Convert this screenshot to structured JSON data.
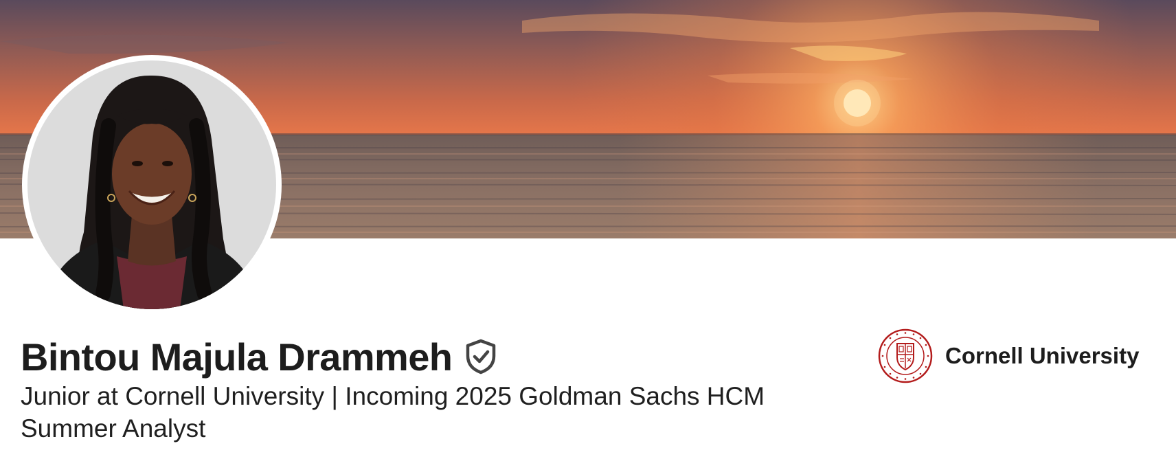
{
  "profile": {
    "name": "Bintou Majula Drammeh",
    "headline_line1": "Junior at Cornell University | Incoming 2025 Goldman Sachs HCM",
    "headline_line2": "Summer Analyst",
    "verified_icon": "verified-shield-icon"
  },
  "education": {
    "school_name": "Cornell University",
    "logo_icon": "cornell-seal-icon"
  },
  "colors": {
    "text": "#1d1d1d",
    "cornell_red": "#b31b1b",
    "sunset_orange": "#e8733a",
    "sea": "#6e5a54"
  }
}
